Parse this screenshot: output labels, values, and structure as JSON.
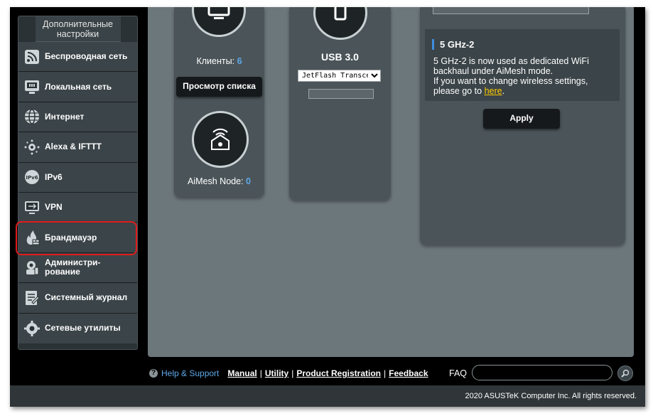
{
  "sidebar": {
    "header": "Дополнительные настройки",
    "items": [
      {
        "label": "Беспроводная сеть",
        "icon": "wireless-icon"
      },
      {
        "label": "Локальная сеть",
        "icon": "lan-icon"
      },
      {
        "label": "Интернет",
        "icon": "globe-icon"
      },
      {
        "label": "Alexa & IFTTT",
        "icon": "alexa-icon"
      },
      {
        "label": "IPv6",
        "icon": "ipv6-icon"
      },
      {
        "label": "VPN",
        "icon": "vpn-icon"
      },
      {
        "label": "Брандмауэр",
        "icon": "firewall-icon"
      },
      {
        "label": "Администри-\nрование",
        "icon": "admin-icon"
      },
      {
        "label": "Системный журнал",
        "icon": "log-icon"
      },
      {
        "label": "Сетевые утилиты",
        "icon": "tools-icon"
      }
    ]
  },
  "clients_card": {
    "clients_label": "Клиенты:",
    "clients_count": "6",
    "view_list_button": "Просмотр списка",
    "aimesh_label": "AiMesh Node:",
    "aimesh_count": "0"
  },
  "usb_card": {
    "title": "USB 3.0",
    "selected_device": "JetFlash Transcend"
  },
  "wireless_info": {
    "band_title": "5 GHz-2",
    "line1": "5 GHz-2 is now used as dedicated WiFi",
    "line2": "backhaul under AiMesh mode.",
    "line3": "If you want to change wireless settings,",
    "line4_prefix": "please go to ",
    "link": "here",
    "line4_suffix": ".",
    "apply_button": "Apply"
  },
  "footer": {
    "help": "Help & Support",
    "links": [
      "Manual",
      "Utility",
      "Product Registration",
      "Feedback"
    ],
    "faq": "FAQ",
    "copyright": "2020 ASUSTeK Computer Inc. All rights reserved."
  },
  "colors": {
    "highlight": "#e01c1c",
    "accent": "#5ea8e8",
    "link": "#ffcc00"
  }
}
